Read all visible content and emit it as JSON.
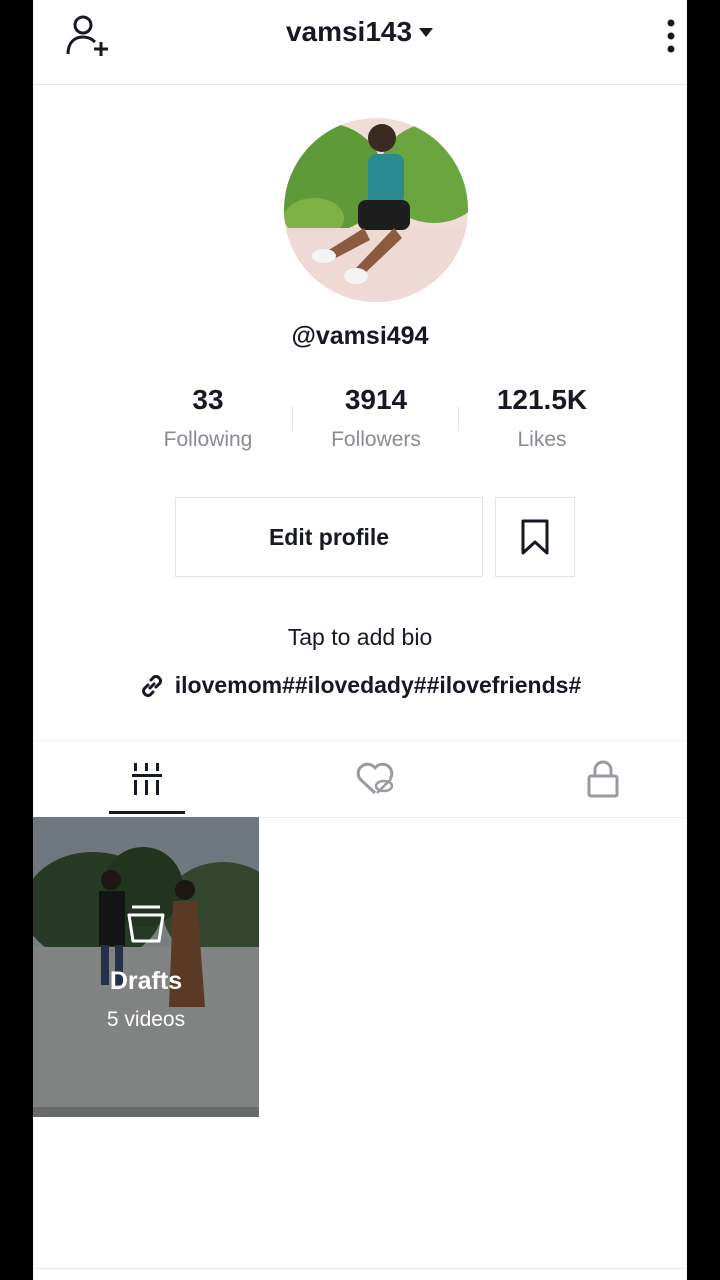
{
  "header": {
    "username": "vamsi143"
  },
  "profile": {
    "handle": "@vamsi494",
    "stats": [
      {
        "value": "33",
        "label": "Following"
      },
      {
        "value": "3914",
        "label": "Followers"
      },
      {
        "value": "121.5K",
        "label": "Likes"
      }
    ],
    "edit_label": "Edit profile",
    "bio_prompt": "Tap to add bio",
    "link_text": "ilovemom##ilovedady##ilovefriends#"
  },
  "drafts": {
    "title": "Drafts",
    "count": "5 videos"
  },
  "icons": {
    "add_user": "person-add-icon",
    "more": "more-vertical-icon",
    "bookmark": "bookmark-icon",
    "link": "link-icon",
    "videos_tab": "grid-bars-icon",
    "liked_tab": "heart-hidden-icon",
    "private_tab": "lock-icon",
    "drafts": "draft-box-icon"
  }
}
